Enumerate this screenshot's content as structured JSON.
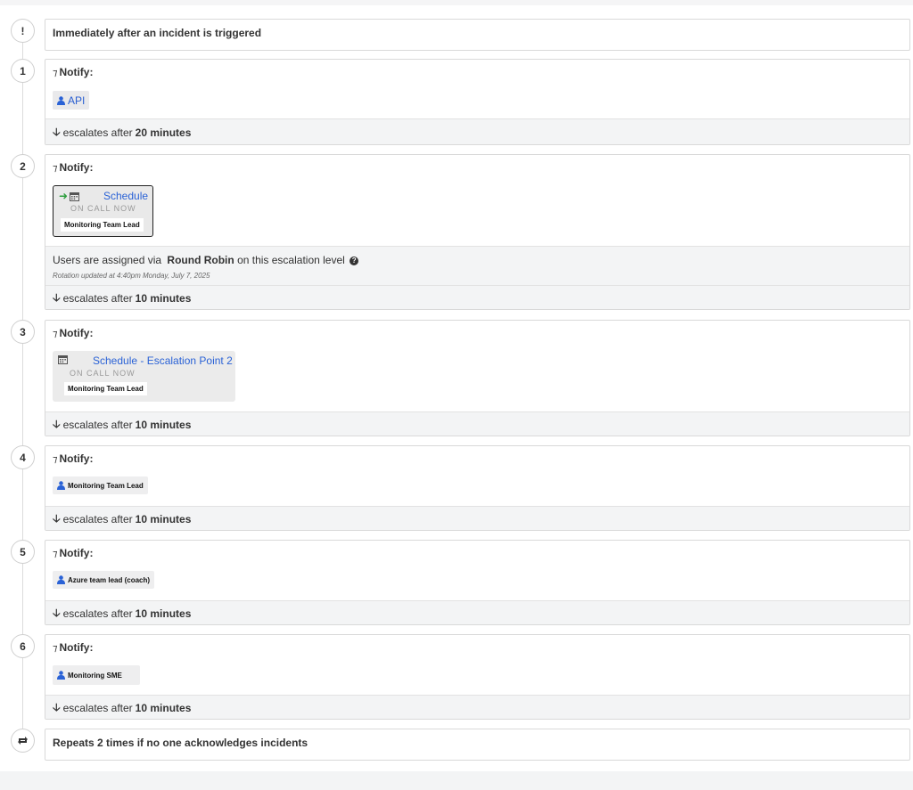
{
  "trigger": {
    "symbol": "!",
    "text": "Immediately after an incident is triggered"
  },
  "notify_label": "Notify:",
  "flag_glyph": "⁊",
  "escalates_prefix": "escalates after",
  "levels": [
    {
      "number": "1",
      "target": "API",
      "escalates": "20 minutes"
    },
    {
      "number": "2",
      "schedule": "Schedule",
      "on_call": "ON CALL NOW",
      "member": "Monitoring Team Lead",
      "round_robin": {
        "prefix": "Users are assigned via",
        "method": "Round Robin",
        "suffix": "on this escalation level"
      },
      "rotation_note": "Rotation updated at 4:40pm Monday, July 7, 2025",
      "escalates": "10 minutes"
    },
    {
      "number": "3",
      "schedule": "Schedule - Escalation Point 2",
      "on_call": "ON CALL NOW",
      "member": "Monitoring Team Lead",
      "escalates": "10 minutes"
    },
    {
      "number": "4",
      "target": "Monitoring Team Lead",
      "escalates": "10 minutes"
    },
    {
      "number": "5",
      "target": "Azure team lead (coach)",
      "escalates": "10 minutes"
    },
    {
      "number": "6",
      "target": "Monitoring SME",
      "escalates": "10 minutes"
    }
  ],
  "repeat": {
    "text": "Repeats 2 times if no one acknowledges incidents"
  },
  "icons": {
    "user": "user-icon",
    "calendar": "calendar-icon",
    "arrow_down": "arrow-down-icon",
    "repeat": "repeat-icon",
    "help": "question-circle-icon",
    "on_call_arrow": "arrow-right-icon"
  },
  "colors": {
    "link": "#2a62d6",
    "on_call_arrow": "#2e9e3e",
    "escalation_bar": "#f3f4f5"
  }
}
